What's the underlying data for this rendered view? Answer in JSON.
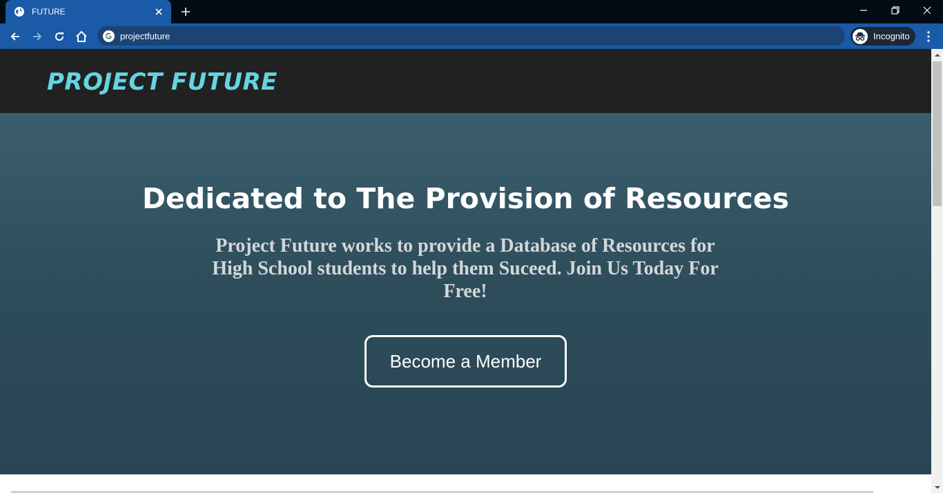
{
  "browser": {
    "tab_title": "FUTURE",
    "url": "projectfuture",
    "incognito_label": "Incognito",
    "icons": {
      "favicon": "globe-icon",
      "close": "close-icon",
      "new_tab": "plus-icon",
      "back": "arrow-left-icon",
      "forward": "arrow-right-icon",
      "reload": "reload-icon",
      "home": "home-icon",
      "site": "google-g-icon",
      "incognito": "incognito-icon",
      "menu": "vertical-dots-icon"
    }
  },
  "site": {
    "brand": "PROJECT FUTURE",
    "hero": {
      "title": "Dedicated to The Provision of Resources",
      "subtitle": "Project Future works to provide a Database of Resources for High School students to help them Suceed. Join Us Today For Free!",
      "cta_label": "Become a Member"
    }
  },
  "colors": {
    "brand_accent": "#66d4e0",
    "header_bg": "#212121",
    "hero_bg_top": "#3b5e6d",
    "hero_bg_bottom": "#294553",
    "browser_blue": "#1a5aa6"
  }
}
